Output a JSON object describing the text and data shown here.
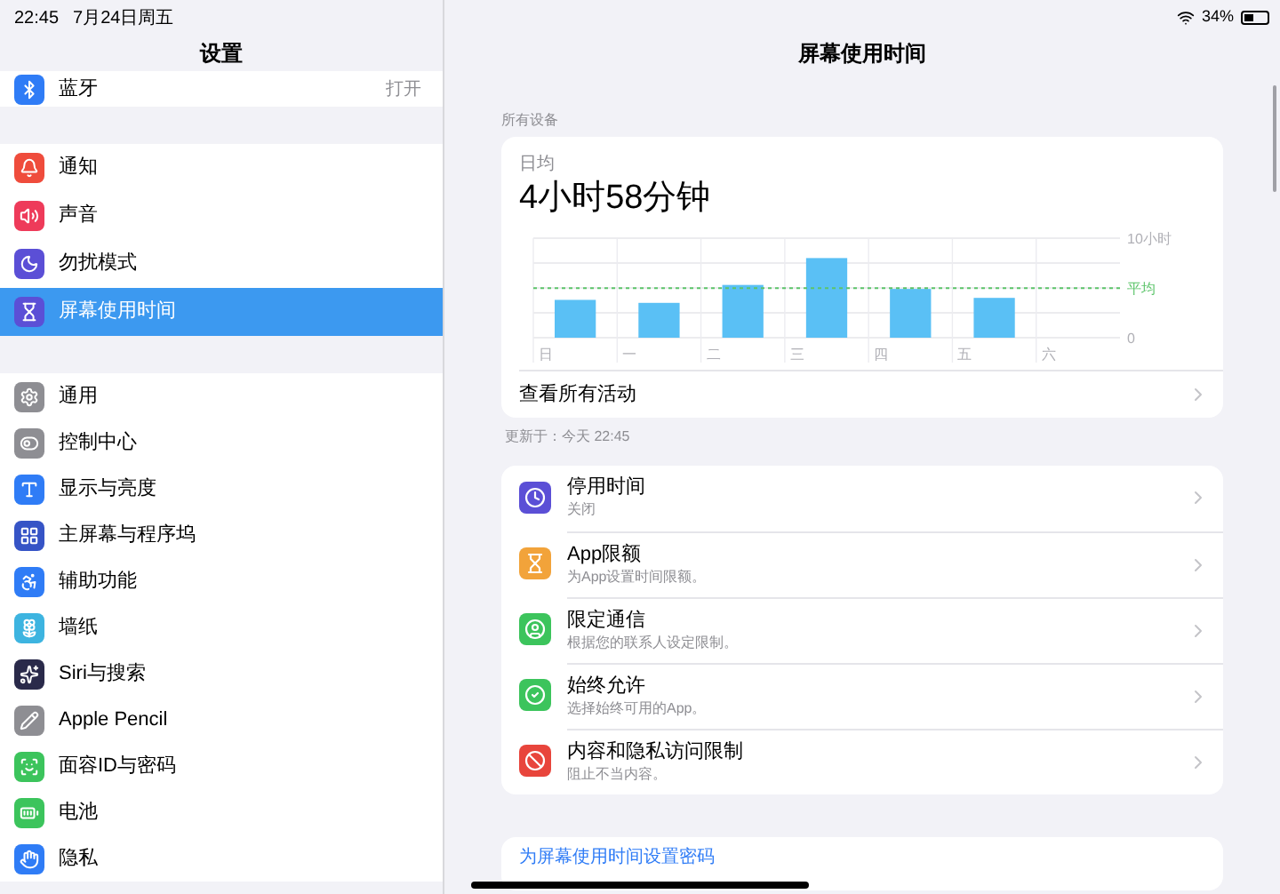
{
  "status_bar": {
    "time": "22:45",
    "date": "7月24日周五",
    "battery": "34%"
  },
  "sidebar": {
    "title": "设置",
    "groups": [
      [
        {
          "label": "蓝牙",
          "value": "打开",
          "selected": false
        }
      ],
      [
        {
          "label": "通知",
          "selected": false
        },
        {
          "label": "声音",
          "selected": false
        },
        {
          "label": "勿扰模式",
          "selected": false
        },
        {
          "label": "屏幕使用时间",
          "selected": true
        }
      ],
      [
        {
          "label": "通用",
          "selected": false
        },
        {
          "label": "控制中心",
          "selected": false
        },
        {
          "label": "显示与亮度",
          "selected": false
        },
        {
          "label": "主屏幕与程序坞",
          "selected": false
        },
        {
          "label": "辅助功能",
          "selected": false
        },
        {
          "label": "墙纸",
          "selected": false
        },
        {
          "label": "Siri与搜索",
          "selected": false
        },
        {
          "label": "Apple Pencil",
          "selected": false
        },
        {
          "label": "面容ID与密码",
          "selected": false
        },
        {
          "label": "电池",
          "selected": false
        },
        {
          "label": "隐私",
          "selected": false
        }
      ]
    ]
  },
  "detail": {
    "title": "屏幕使用时间",
    "section_label": "所有设备",
    "summary": {
      "label": "日均",
      "value": "4小时58分钟",
      "chart_data": {
        "type": "bar",
        "categories": [
          "日",
          "一",
          "二",
          "三",
          "四",
          "五",
          "六"
        ],
        "values": [
          3.8,
          3.5,
          5.3,
          8,
          4.9,
          4,
          0
        ],
        "ylim": [
          0,
          10
        ],
        "yticks": [
          0,
          {
            "value": 10,
            "label": "10小时"
          }
        ],
        "ref_lines": [
          {
            "axis": "y",
            "value": 4.97,
            "label": "平均"
          }
        ]
      },
      "link": "查看所有活动"
    },
    "updated": "更新于：今天 22:45",
    "options": [
      {
        "title": "停用时间",
        "subtitle": "关闭"
      },
      {
        "title": "App限额",
        "subtitle": "为App设置时间限额。"
      },
      {
        "title": "限定通信",
        "subtitle": "根据您的联系人设定限制。"
      },
      {
        "title": "始终允许",
        "subtitle": "选择始终可用的App。"
      },
      {
        "title": "内容和隐私访问限制",
        "subtitle": "阻止不当内容。"
      }
    ],
    "passcode_link": "为屏幕使用时间设置密码"
  }
}
